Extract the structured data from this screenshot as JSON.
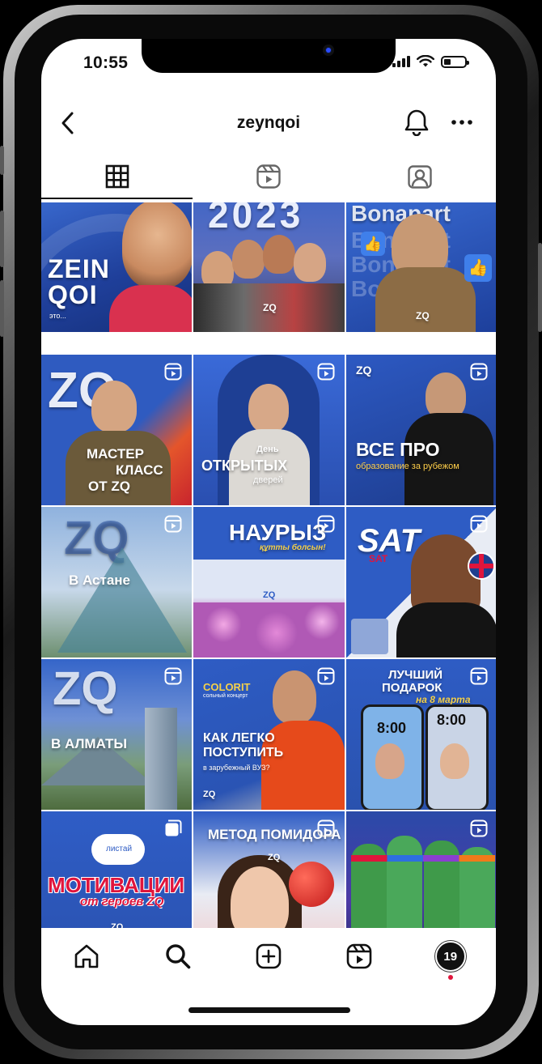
{
  "status_bar": {
    "time": "10:55"
  },
  "header": {
    "username": "zeynqoi",
    "back_icon": "chevron-left-icon",
    "bell_icon": "bell-icon",
    "more_icon": "more-horizontal-icon"
  },
  "tabs": [
    {
      "name": "grid",
      "icon": "grid-icon",
      "active": true
    },
    {
      "name": "reels",
      "icon": "reels-icon",
      "active": false
    },
    {
      "name": "tagged",
      "icon": "tagged-user-icon",
      "active": false
    }
  ],
  "posts": {
    "p1": {
      "line1": "ZEIN",
      "line2": "QOI",
      "sub": "это..."
    },
    "p2": {
      "year": "2023",
      "logo": "ZQ"
    },
    "p3": {
      "title": "Bonapart",
      "logo": "ZQ"
    },
    "p4": {
      "logo": "ZQ",
      "line1": "МАСТЕР",
      "line2": "КЛАСС",
      "line3": "ОТ ZQ"
    },
    "p5": {
      "sub": "День",
      "line1": "ОТКРЫТЫХ",
      "line2": "дверей"
    },
    "p6": {
      "logo": "ZQ",
      "line1": "ВСЕ ПРО",
      "sub": "образование за рубежом"
    },
    "p7": {
      "logo": "ZQ",
      "line1": "В Астане"
    },
    "p8": {
      "line1": "НАУРЫЗ",
      "sub": "құтты болсын!",
      "logo": "ZQ"
    },
    "p9": {
      "line1": "SAT",
      "sub": "SAT"
    },
    "p10": {
      "logo": "ZQ",
      "line1": "В АЛМАТЫ"
    },
    "p11": {
      "brand": "COLORIT",
      "brand_sub": "сольный концерт",
      "line1": "КАК ЛЕГКО",
      "line2": "ПОСТУПИТЬ",
      "sub": "в зарубежный ВУЗ?",
      "logo": "ZQ"
    },
    "p12": {
      "line1": "ЛУЧШИЙ",
      "line2": "ПОДАРОК",
      "sub": "на 8 марта",
      "clock": "8:00"
    },
    "p13": {
      "cloud": "листай",
      "line1": "МОТИВАЦИИ",
      "sub": "от героев ZQ",
      "logo": "ZQ"
    },
    "p14": {
      "line1": "МЕТОД ПОМИДОРА",
      "logo": "ZQ"
    },
    "p15": {}
  },
  "bottom_nav": [
    {
      "name": "home",
      "icon": "home-icon"
    },
    {
      "name": "search",
      "icon": "search-icon"
    },
    {
      "name": "create",
      "icon": "plus-square-icon"
    },
    {
      "name": "reels",
      "icon": "reels-icon"
    },
    {
      "name": "profile",
      "icon": "avatar",
      "label": "19"
    }
  ],
  "colors": {
    "brand_blue": "#2a57b8",
    "accent_red": "#e0153c",
    "text": "#111111"
  }
}
